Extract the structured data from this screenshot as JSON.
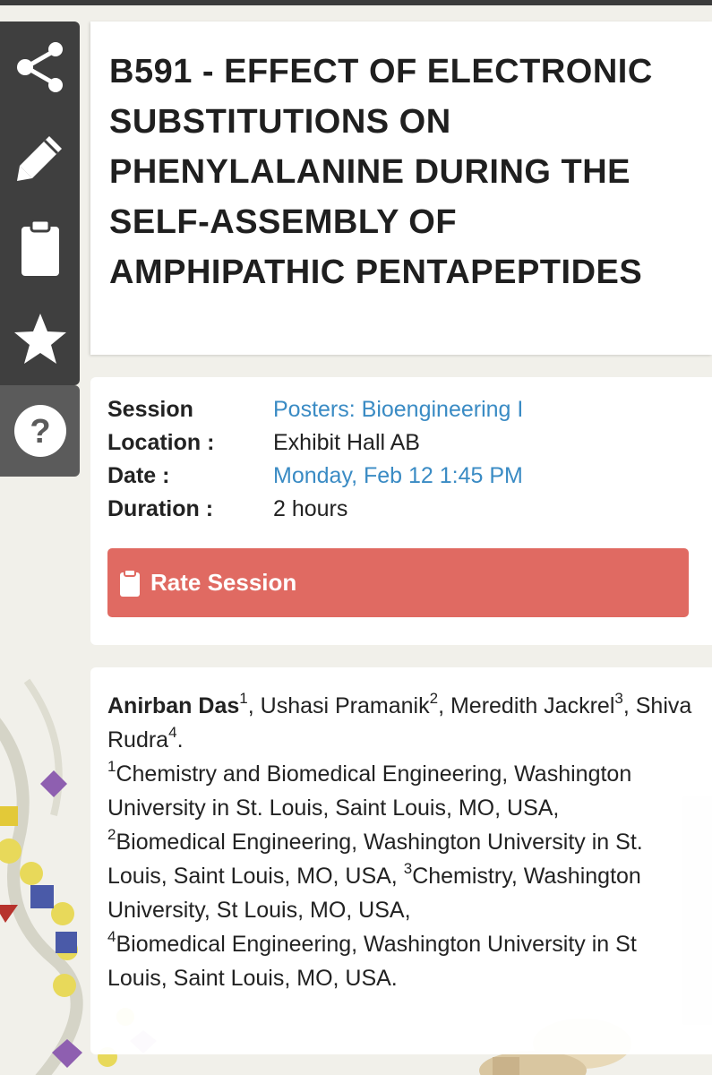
{
  "toolbar": {
    "tools": [
      {
        "name": "share",
        "icon": "share-icon"
      },
      {
        "name": "edit",
        "icon": "pencil-icon"
      },
      {
        "name": "clipboard",
        "icon": "clipboard-icon"
      },
      {
        "name": "favorite",
        "icon": "star-icon"
      },
      {
        "name": "help",
        "icon": "question-icon"
      }
    ]
  },
  "abstract": {
    "title": "B591 - EFFECT OF ELECTRONIC SUBSTITUTIONS ON PHENYLALANINE DURING THE SELF-ASSEMBLY OF AMPHIPATHIC PENTAPEPTIDES"
  },
  "info": {
    "session_label": "Session",
    "session_value": "Posters: Bioengineering I",
    "location_label": "Location :",
    "location_value": "Exhibit Hall AB",
    "date_label": "Date :",
    "date_value": "Monday, Feb 12 1:45 PM",
    "duration_label": "Duration :",
    "duration_value": "2 hours"
  },
  "rate_button": {
    "label": "Rate Session",
    "icon": "clipboard-icon",
    "color": "#e06a62"
  },
  "authors": {
    "list": [
      {
        "name": "Anirban Das",
        "sup": "1",
        "sep": ", "
      },
      {
        "name": "Ushasi Pramanik",
        "sup": "2",
        "sep": ", "
      },
      {
        "name": "Meredith Jackrel",
        "sup": "3",
        "sep": ", "
      },
      {
        "name": "Shiva Rudra",
        "sup": "4",
        "sep": "."
      }
    ],
    "affiliations": [
      {
        "num": "1",
        "text": "Chemistry and Biomedical Engineering, Washington University in St. Louis, Saint Louis, MO, USA,"
      },
      {
        "num": "2",
        "text": "Biomedical Engineering, Washington University in St. Louis, Saint Louis, MO, USA,"
      },
      {
        "num": "3",
        "text": "Chemistry, Washington University, St Louis, MO, USA,"
      },
      {
        "num": "4",
        "text": "Biomedical Engineering, Washington University in St Louis, Saint Louis, MO, USA."
      }
    ]
  },
  "colors": {
    "toolbar_bg": "#3f3f3f",
    "help_bg": "#5b5b5b",
    "link": "#3a8bc4",
    "page_bg": "#f1f0ea"
  }
}
